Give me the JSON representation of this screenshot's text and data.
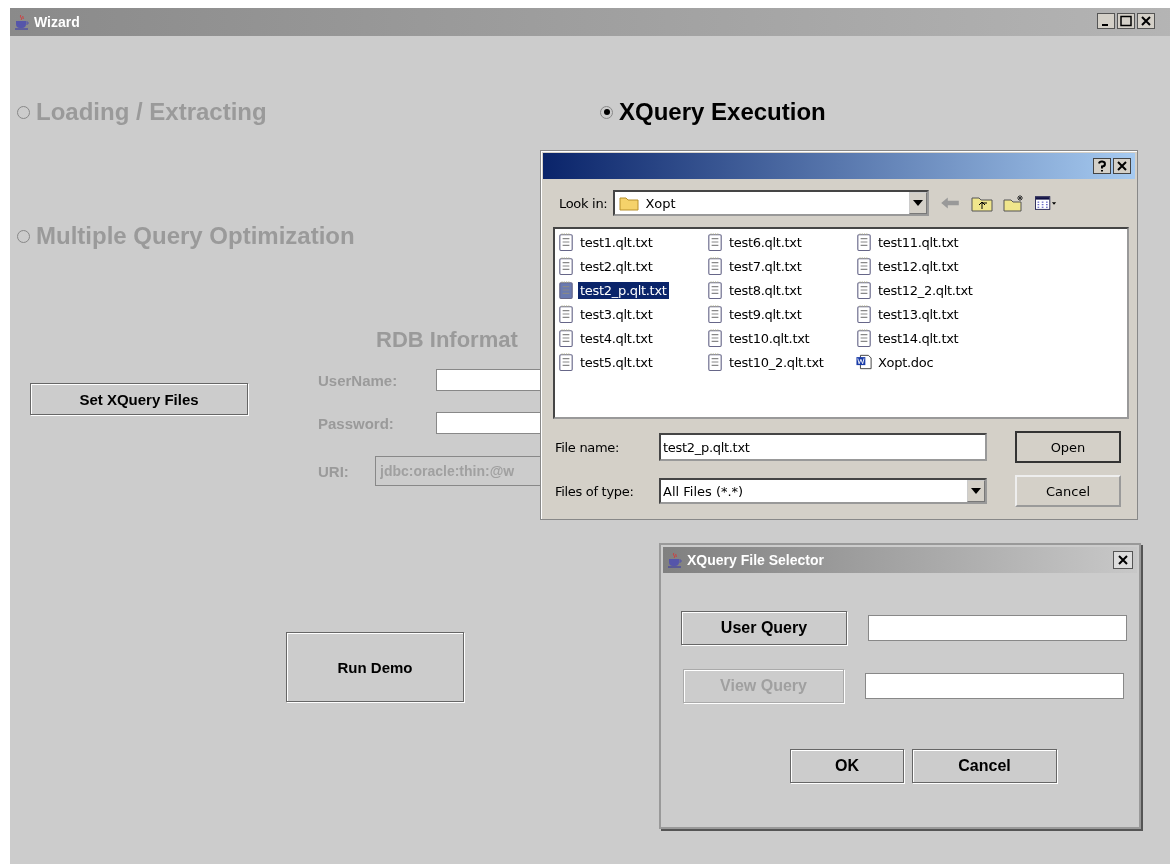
{
  "window": {
    "title": "Wizard"
  },
  "modes": [
    {
      "label": "Loading / Extracting",
      "selected": false,
      "disabled": true
    },
    {
      "label": "XQuery Execution",
      "selected": true,
      "disabled": false
    },
    {
      "label": "Multiple Query Optimization",
      "selected": false,
      "disabled": true
    }
  ],
  "set_files_button": "Set XQuery Files",
  "rdb": {
    "heading": "RDB Informat",
    "fields": [
      {
        "label": "UserName:",
        "disabled": true
      },
      {
        "label": "Password:",
        "disabled": true
      },
      {
        "label": "URI:",
        "value": "jdbc:oracle:thin:@w",
        "disabled": true
      }
    ]
  },
  "run_button": "Run Demo",
  "file_dialog": {
    "look_in_label": "Look in:",
    "look_in": "Xopt",
    "files": [
      {
        "name": "test1.qlt.txt",
        "kind": "text",
        "selected": false
      },
      {
        "name": "test2.qlt.txt",
        "kind": "text",
        "selected": false
      },
      {
        "name": "test2_p.qlt.txt",
        "kind": "text",
        "selected": true
      },
      {
        "name": "test3.qlt.txt",
        "kind": "text",
        "selected": false
      },
      {
        "name": "test4.qlt.txt",
        "kind": "text",
        "selected": false
      },
      {
        "name": "test5.qlt.txt",
        "kind": "text",
        "selected": false
      },
      {
        "name": "test6.qlt.txt",
        "kind": "text",
        "selected": false
      },
      {
        "name": "test7.qlt.txt",
        "kind": "text",
        "selected": false
      },
      {
        "name": "test8.qlt.txt",
        "kind": "text",
        "selected": false
      },
      {
        "name": "test9.qlt.txt",
        "kind": "text",
        "selected": false
      },
      {
        "name": "test10.qlt.txt",
        "kind": "text",
        "selected": false
      },
      {
        "name": "test10_2.qlt.txt",
        "kind": "text",
        "selected": false
      },
      {
        "name": "test11.qlt.txt",
        "kind": "text",
        "selected": false
      },
      {
        "name": "test12.qlt.txt",
        "kind": "text",
        "selected": false
      },
      {
        "name": "test12_2.qlt.txt",
        "kind": "text",
        "selected": false
      },
      {
        "name": "test13.qlt.txt",
        "kind": "text",
        "selected": false
      },
      {
        "name": "test14.qlt.txt",
        "kind": "text",
        "selected": false
      },
      {
        "name": "Xopt.doc",
        "kind": "doc",
        "selected": false
      }
    ],
    "file_name_label": "File name:",
    "file_name": "test2_p.qlt.txt",
    "type_label": "Files of type:",
    "type": "All Files (*.*)",
    "buttons": [
      "Open",
      "Cancel"
    ]
  },
  "selector": {
    "title": "XQuery File Selector",
    "rows": [
      {
        "button": "User Query",
        "disabled": false
      },
      {
        "button": "View Query",
        "disabled": true
      }
    ],
    "buttons": [
      "OK",
      "Cancel"
    ]
  }
}
